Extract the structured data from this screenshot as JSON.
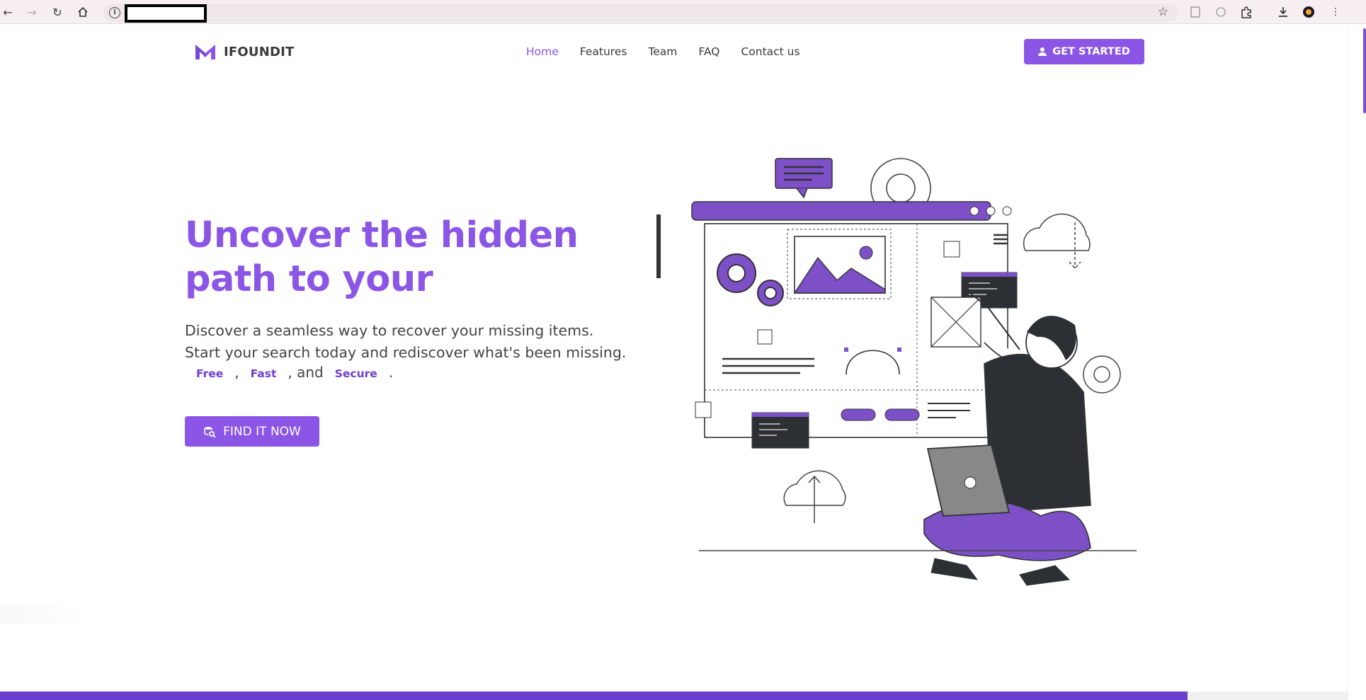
{
  "browser": {
    "nav_icons": [
      "back-arrow-icon",
      "forward-arrow-icon",
      "reload-icon",
      "home-icon"
    ],
    "address_icon": "site-info-icon",
    "toolbar_icons": [
      "bookmark-star-icon",
      "extension-doc-icon",
      "extension-circle-icon",
      "extensions-puzzle-icon",
      "download-icon",
      "profile-avatar-icon",
      "menu-kebab-icon"
    ]
  },
  "brand": {
    "name": "IFOUNDIT",
    "accent": "#8b55e6",
    "dark_accent": "#6a3fcf"
  },
  "nav": {
    "items": [
      {
        "label": "Home",
        "active": true
      },
      {
        "label": "Features",
        "active": false
      },
      {
        "label": "Team",
        "active": false
      },
      {
        "label": "FAQ",
        "active": false
      },
      {
        "label": "Contact us",
        "active": false
      }
    ],
    "cta_label": "GET STARTED"
  },
  "hero": {
    "title": "Uncover the hidden path to your",
    "subtitle_line1": "Discover a seamless way to recover your missing items.",
    "subtitle_line2": "Start your search today and rediscover what's been missing.",
    "tags": [
      "Free",
      "Fast",
      "Secure"
    ],
    "sep_comma": ",",
    "sep_and": ", and",
    "sep_end": ".",
    "button_label": "FIND IT NOW"
  },
  "scroll_progress": 0.881
}
